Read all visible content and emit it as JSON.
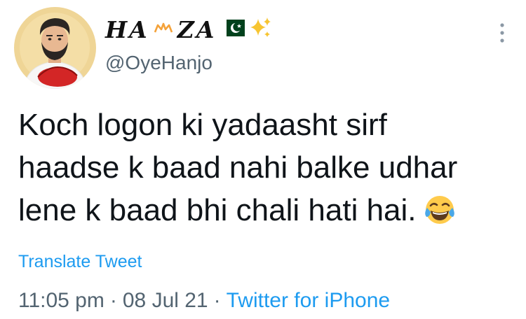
{
  "tweet": {
    "author": {
      "display_name": "HA",
      "display_name_end": "ZA",
      "handle": "@OyeHanjo",
      "avatar_icon": "profile-avatar",
      "name_icons": [
        "crown-icon",
        "pakistan-flag-icon",
        "sparkles-icon"
      ]
    },
    "text_lines": [
      "Koch logon ki yadaasht sirf",
      "haadse k baad nahi balke udhar",
      "lene k baad bhi chali hati hai."
    ],
    "emoji_icon": "face-with-tears-of-joy-icon",
    "translate_label": "Translate Tweet",
    "time": "11:05 pm",
    "date": "08 Jul 21",
    "separator": "·",
    "source": "Twitter for iPhone",
    "colors": {
      "link": "#1d9bf0",
      "secondary_text": "#536471",
      "primary_text": "#0f1419"
    }
  }
}
